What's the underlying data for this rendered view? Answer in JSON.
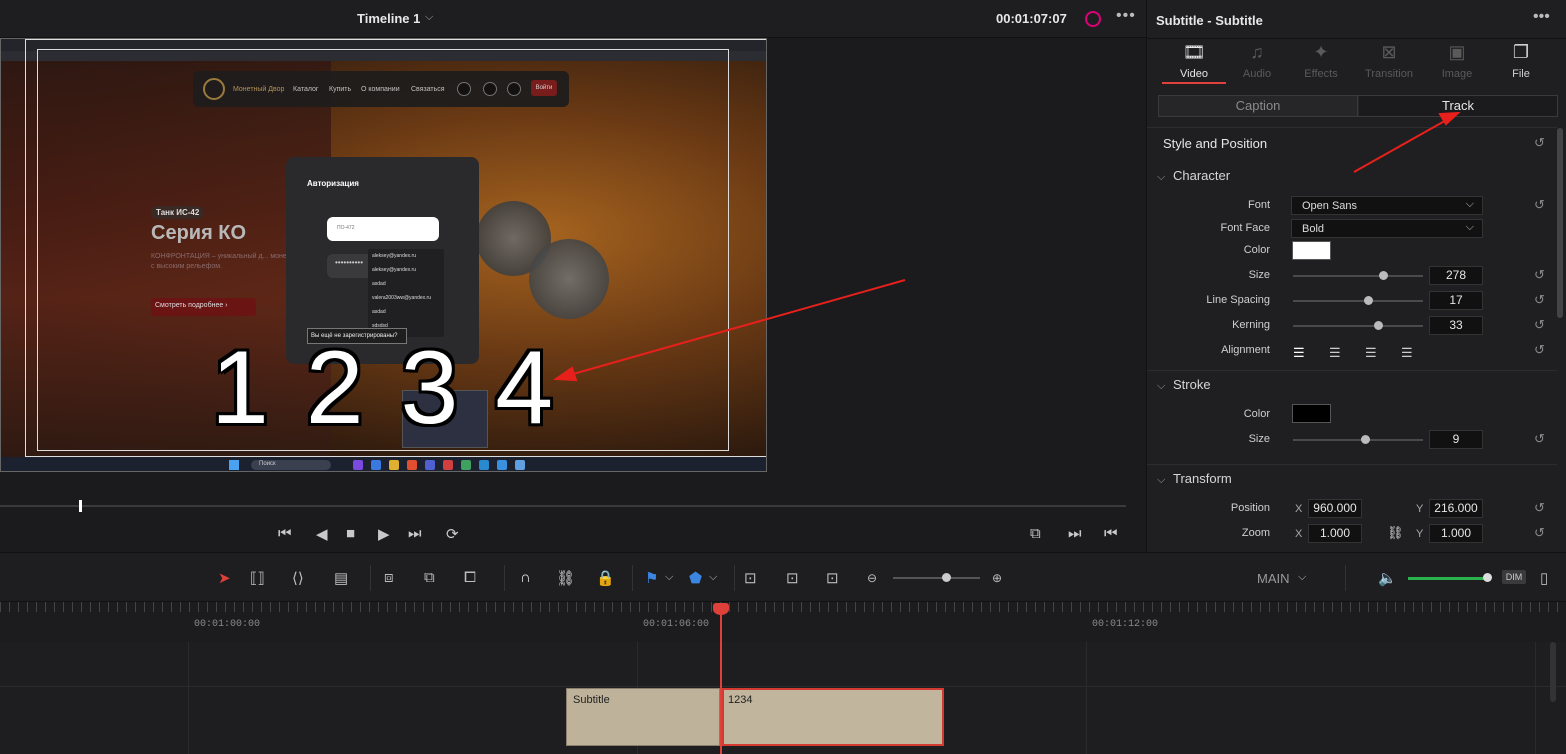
{
  "viewer": {
    "title": "Timeline 1",
    "timecode": "00:01:07:07",
    "options": "•••"
  },
  "frame": {
    "nav_brand": "Монетный Двор",
    "nav_items": [
      "Каталог",
      "Купить",
      "О компании",
      "Связаться"
    ],
    "nav_login": "Войти",
    "hero_badge": "Танк ИС-42",
    "hero_title": "Серия КО",
    "hero_desc": "КОНФРОНТАЦИЯ – уникальный д... монет с высоким рельефом.",
    "hero_button": "Смотреть подробнее ›",
    "auth_title": "Авторизация",
    "auth_login_placeholder": "ПО-472",
    "auth_password": "••••••••••",
    "suggestions": [
      "aleksey@yandex.ru",
      "aleksey@yandex.ru",
      "asdad",
      "valera2003ww@yandex.ru",
      "asdad",
      "sdsdsd"
    ],
    "no_account": "Вы ещё не зарегистрированы?",
    "subtitle_text": "1 2 3 4",
    "taskbar_search": "Поиск"
  },
  "toolbar": {
    "track_select": "MAIN",
    "dim": "DIM"
  },
  "ruler": {
    "labels": [
      "00:01:00:00",
      "00:01:06:00",
      "00:01:12:00"
    ]
  },
  "clips": {
    "clip1": "Subtitle",
    "clip2": "1234"
  },
  "inspector": {
    "title": "Subtitle - Subtitle",
    "tabs": [
      {
        "label": "Video",
        "icon": "film-icon",
        "active": true
      },
      {
        "label": "Audio",
        "icon": "music-note-icon",
        "active": false
      },
      {
        "label": "Effects",
        "icon": "magic-wand-icon",
        "active": false
      },
      {
        "label": "Transition",
        "icon": "transition-icon",
        "active": false
      },
      {
        "label": "Image",
        "icon": "image-icon",
        "active": false
      },
      {
        "label": "File",
        "icon": "file-icon",
        "active": false
      }
    ],
    "segment": {
      "caption": "Caption",
      "track": "Track",
      "selected": "Track"
    },
    "style_position": "Style and Position",
    "character": {
      "heading": "Character",
      "font_label": "Font",
      "font_value": "Open Sans",
      "face_label": "Font Face",
      "face_value": "Bold",
      "color_label": "Color",
      "color_value": "#ffffff",
      "size_label": "Size",
      "size_value": "278",
      "line_spacing_label": "Line Spacing",
      "line_spacing_value": "17",
      "kerning_label": "Kerning",
      "kerning_value": "33",
      "alignment_label": "Alignment"
    },
    "stroke": {
      "heading": "Stroke",
      "color_label": "Color",
      "color_value": "#000000",
      "size_label": "Size",
      "size_value": "9"
    },
    "transform": {
      "heading": "Transform",
      "position_label": "Position",
      "x_label": "X",
      "y_label": "Y",
      "position_x": "960.000",
      "position_y": "216.000",
      "zoom_label": "Zoom",
      "zoom_x": "1.000",
      "zoom_y": "1.000"
    }
  },
  "colors": {
    "accent": "#e0403a",
    "clip": "#bfb29a",
    "volume": "#2bb24c"
  }
}
